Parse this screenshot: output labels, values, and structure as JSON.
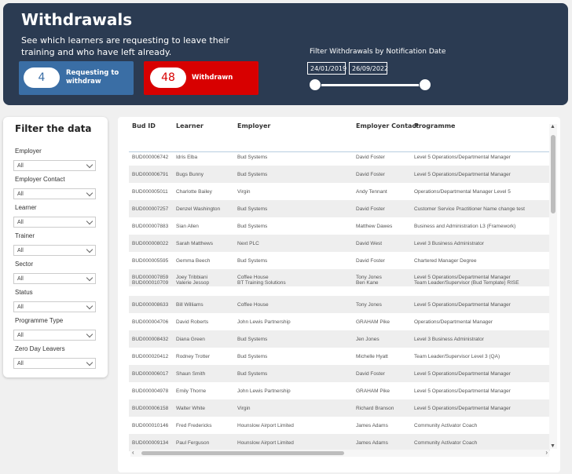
{
  "header": {
    "title": "Withdrawals",
    "subtitle": "See which learners are requesting to leave their training and who have left already."
  },
  "kpis": {
    "requesting": {
      "value": "4",
      "label": "Requesting to withdraw",
      "color": "#3a6ea5"
    },
    "withdrawn": {
      "value": "48",
      "label": "Withdrawn",
      "color": "#d80000"
    }
  },
  "date_filter": {
    "title": "Filter Withdrawals by Notification Date",
    "start": "24/01/2019",
    "end": "26/09/2022"
  },
  "filters": {
    "heading": "Filter the data",
    "slicers": [
      {
        "label": "Employer",
        "value": "All"
      },
      {
        "label": "Employer Contact",
        "value": "All"
      },
      {
        "label": "Learner",
        "value": "All"
      },
      {
        "label": "Trainer",
        "value": "All"
      },
      {
        "label": "Sector",
        "value": "All"
      },
      {
        "label": "Status",
        "value": "All"
      },
      {
        "label": "Programme Type",
        "value": "All"
      },
      {
        "label": "Zero Day Leavers",
        "value": "All"
      }
    ]
  },
  "table": {
    "columns": [
      "Bud ID",
      "Learner",
      "Employer",
      "Employer Contact",
      "Programme"
    ],
    "rows": [
      [
        "BUD000006742",
        "Idris Elba",
        "Bud Systems",
        "David Foster",
        "Level 5   Operations/Departmental Manager"
      ],
      [
        "BUD000006791",
        "Bugs Bunny",
        "Bud Systems",
        "David Foster",
        "Level 5   Operations/Departmental Manager"
      ],
      [
        "BUD000005011",
        "Charlotte Bailey",
        "Virgin",
        "Andy Tennant",
        "Operations/Departmental Manager   Level 5"
      ],
      [
        "BUD000007257",
        "Denzel Washington",
        "Bud Systems",
        "David Foster",
        "Customer Service Practitioner   Name change test"
      ],
      [
        "BUD000007883",
        "Sian Allen",
        "Bud Systems",
        "Matthew Dawes",
        "Business and Administration L3 (Framework)"
      ],
      [
        "BUD000008022",
        "Sarah Matthews",
        "Next PLC",
        "David West",
        "Level 3   Business Administrator"
      ],
      [
        "BUD000005595",
        "Gemma Beech",
        "Bud Systems",
        "David Foster",
        "Chartered Manager Degree"
      ],
      [
        "BUD000007859",
        "Joey Tribbiani",
        "Coffee House",
        "Tony Jones",
        "Level 5   Operations/Departmental Manager"
      ],
      [
        "BUD000010709",
        "Valerie Jessop",
        "BT Training Solutions",
        "Ben Kane",
        "Team Leader/Supervisor   (Bud Template)   RISE"
      ],
      [
        "BUD000008633",
        "Bill Williams",
        "Coffee House",
        "Tony Jones",
        "Level 5   Operations/Departmental Manager"
      ],
      [
        "BUD000004706",
        "David Roberts",
        "John Lewis Partnership",
        "GRAHAM Pike",
        "Operations/Departmental Manager"
      ],
      [
        "BUD000008432",
        "Diana Green",
        "Bud Systems",
        "Jen Jones",
        "Level 3   Business Administrator"
      ],
      [
        "BUD000020412",
        "Rodney Trotter",
        "Bud Systems",
        "Michelle Hyatt",
        "Team Leader/Supervisor Level 3 (QA)"
      ],
      [
        "BUD000006017",
        "Shaun Smith",
        "Bud Systems",
        "David Foster",
        "Level 5   Operations/Departmental Manager"
      ],
      [
        "BUD000004978",
        "Emily Thorne",
        "John Lewis Partnership",
        "GRAHAM Pike",
        "Level 5   Operations/Departmental Manager"
      ],
      [
        "BUD000006158",
        "Walter White",
        "Virgin",
        "Richard Branson",
        "Level 5   Operations/Departmental Manager"
      ],
      [
        "BUD000010146",
        "Fred Fredericks",
        "Hounslow Airport Limited",
        "James Adams",
        "Community Activator Coach"
      ],
      [
        "BUD000009134",
        "Paul Ferguson",
        "Hounslow Airport Limited",
        "James Adams",
        "Community Activator Coach"
      ]
    ]
  }
}
